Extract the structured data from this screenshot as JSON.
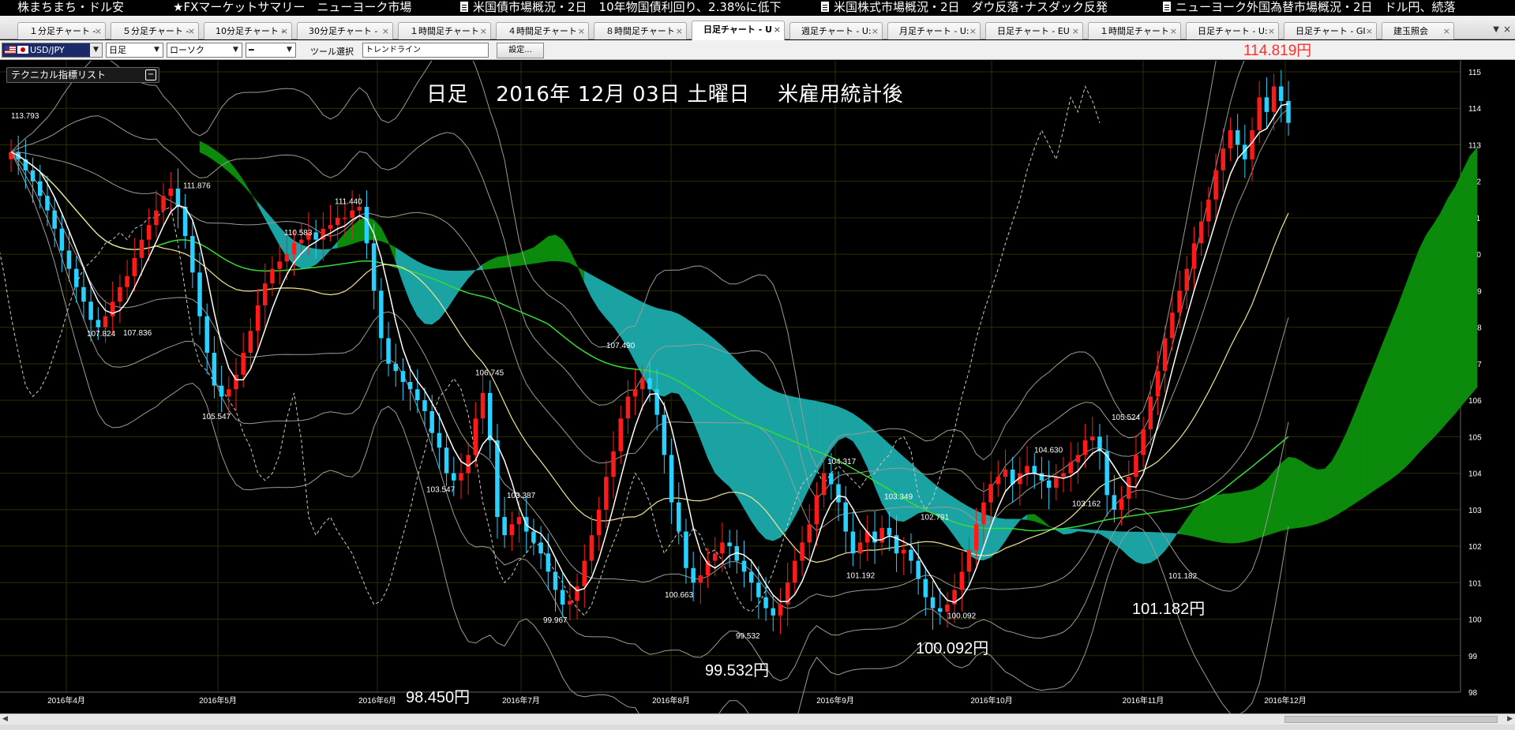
{
  "ticker": [
    {
      "text": "株まちまち・ドル安",
      "icon": false
    },
    {
      "text": "★FXマーケットサマリー　ニューヨーク市場",
      "icon": false
    },
    {
      "text": "米国債市場概況・2日　10年物国債利回り、2.38%に低下",
      "icon": true
    },
    {
      "text": "米国株式市場概況・2日　ダウ反落･ナスダック反発",
      "icon": true
    },
    {
      "text": "ニューヨーク外国為替市場概況・2日　ドル円、続落",
      "icon": true
    }
  ],
  "tabs": [
    {
      "label": "１分足チャート -",
      "active": false
    },
    {
      "label": "５分足チャート -",
      "active": false
    },
    {
      "label": "10分足チャート -",
      "active": false
    },
    {
      "label": "30分足チャート -",
      "active": false
    },
    {
      "label": "１時間足チャート",
      "active": false
    },
    {
      "label": "４時間足チャート",
      "active": false
    },
    {
      "label": "８時間足チャート",
      "active": false
    },
    {
      "label": "日足チャート - U",
      "active": true
    },
    {
      "label": "週足チャート - U:",
      "active": false
    },
    {
      "label": "月足チャート - U:",
      "active": false
    },
    {
      "label": "日足チャート - EU",
      "active": false
    },
    {
      "label": "１時間足チャート",
      "active": false
    },
    {
      "label": "日足チャート - U:",
      "active": false
    },
    {
      "label": "日足チャート - GI",
      "active": false
    },
    {
      "label": "建玉照会",
      "active": false
    }
  ],
  "toolbar": {
    "pair": "USD/JPY",
    "period": "日足",
    "chart_type": "ローソク",
    "line_style": "━",
    "tool_label": "ツール選択",
    "tool_value": "トレンドライン",
    "settings": "設定..."
  },
  "current_price": "114.819円",
  "indicator_panel": {
    "title": "テクニカル指標リスト",
    "button": "−"
  },
  "colors": {
    "up_candle": "#ff1a1a",
    "down_candle": "#2ad0ff",
    "cloud_bullish": "#0b8a0b",
    "cloud_bearish": "#1ba3a3",
    "sma_long": "#33dd33",
    "tenkan": "#ffffff",
    "sma_mid": "#f3e39a",
    "chikou": "#cccccc",
    "bollinger": "#9a9a9a",
    "price_label": "#ff3030"
  },
  "chart_data": {
    "type": "candlestick",
    "title": "日足　 2016年 12月 03日 土曜日　 米雇用統計後",
    "ylim": [
      98,
      115
    ],
    "yticks": [
      "115",
      "114",
      "113",
      "112",
      "111",
      "110",
      "109",
      "108",
      "107",
      "106",
      "105",
      "104",
      "103",
      "102",
      "101",
      "100",
      "99",
      "98"
    ],
    "xtick_labels": [
      "2016年4月",
      "2016年5月",
      "2016年6月",
      "2016年7月",
      "2016年8月",
      "2016年9月",
      "2016年10月",
      "2016年11月",
      "2016年12月"
    ],
    "series": [
      {
        "name": "USD/JPY",
        "close": [
          112.8,
          112.6,
          112.3,
          112.0,
          111.6,
          111.2,
          110.7,
          110.1,
          109.6,
          109.1,
          108.7,
          108.2,
          108.0,
          108.3,
          108.7,
          109.1,
          109.4,
          109.9,
          110.4,
          110.8,
          111.2,
          111.6,
          111.8,
          111.3,
          110.5,
          109.5,
          108.3,
          107.3,
          106.4,
          106.1,
          106.3,
          106.7,
          107.3,
          107.9,
          108.6,
          109.2,
          109.6,
          109.8,
          110.0,
          110.3,
          110.4,
          110.6,
          110.4,
          110.7,
          110.8,
          111.0,
          111.0,
          111.2,
          111.3,
          110.3,
          109.0,
          107.7,
          107.0,
          106.8,
          106.5,
          106.3,
          106.0,
          105.7,
          105.1,
          104.7,
          104.0,
          103.8,
          104.0,
          104.5,
          105.5,
          106.2,
          104.9,
          102.8,
          102.3,
          102.6,
          102.8,
          102.4,
          102.1,
          101.8,
          101.3,
          100.8,
          100.4,
          100.5,
          100.9,
          101.6,
          102.3,
          103.0,
          103.9,
          104.6,
          105.5,
          106.1,
          106.3,
          106.6,
          106.3,
          105.6,
          104.5,
          103.2,
          102.4,
          101.4,
          101.0,
          101.2,
          101.6,
          101.8,
          102.1,
          102.0,
          101.6,
          101.3,
          101.0,
          100.6,
          100.3,
          100.1,
          100.4,
          101.0,
          101.6,
          102.1,
          102.6,
          103.4,
          104.0,
          103.7,
          103.2,
          102.4,
          101.8,
          102.1,
          102.4,
          102.1,
          102.5,
          102.3,
          101.8,
          101.9,
          101.6,
          101.1,
          100.6,
          100.3,
          100.2,
          100.4,
          100.8,
          101.3,
          101.9,
          102.6,
          103.2,
          103.7,
          103.9,
          104.1,
          103.7,
          104.0,
          104.2,
          104.0,
          103.8,
          103.6,
          103.9,
          104.0,
          104.3,
          104.5,
          104.9,
          105.0,
          104.6,
          103.4,
          103.0,
          103.3,
          103.9,
          104.5,
          105.2,
          106.1,
          106.8,
          107.7,
          108.4,
          109.0,
          109.6,
          110.3,
          110.9,
          111.5,
          112.3,
          112.9,
          113.4,
          113.0,
          112.6,
          113.4,
          114.3,
          113.9,
          114.6,
          114.2,
          113.6
        ]
      },
      {
        "name": "annotations",
        "points": [
          {
            "label": "113.793",
            "value": 113.793
          },
          {
            "label": "111.876",
            "value": 111.876
          },
          {
            "label": "111.440",
            "value": 111.44
          },
          {
            "label": "110.583",
            "value": 110.583
          },
          {
            "label": "107.824",
            "value": 107.824
          },
          {
            "label": "107.836",
            "value": 107.836
          },
          {
            "label": "105.547",
            "value": 105.547
          },
          {
            "label": "106.745",
            "value": 106.745
          },
          {
            "label": "107.490",
            "value": 107.49
          },
          {
            "label": "103.547",
            "value": 103.547
          },
          {
            "label": "103.387",
            "value": 103.387
          },
          {
            "label": "99.967",
            "value": 99.967
          },
          {
            "label": "100.663",
            "value": 100.663
          },
          {
            "label": "99.532",
            "value": 99.532
          },
          {
            "label": "104.317",
            "value": 104.317
          },
          {
            "label": "103.349",
            "value": 103.349
          },
          {
            "label": "101.192",
            "value": 101.192
          },
          {
            "label": "102.791",
            "value": 102.791
          },
          {
            "label": "100.092",
            "value": 100.092
          },
          {
            "label": "104.630",
            "value": 104.63
          },
          {
            "label": "103.162",
            "value": 103.162
          },
          {
            "label": "105.524",
            "value": 105.524
          },
          {
            "label": "101.182",
            "value": 101.182
          }
        ]
      }
    ],
    "big_labels": [
      "98.450円",
      "99.532円",
      "100.092円",
      "101.182円"
    ],
    "grid": true
  }
}
